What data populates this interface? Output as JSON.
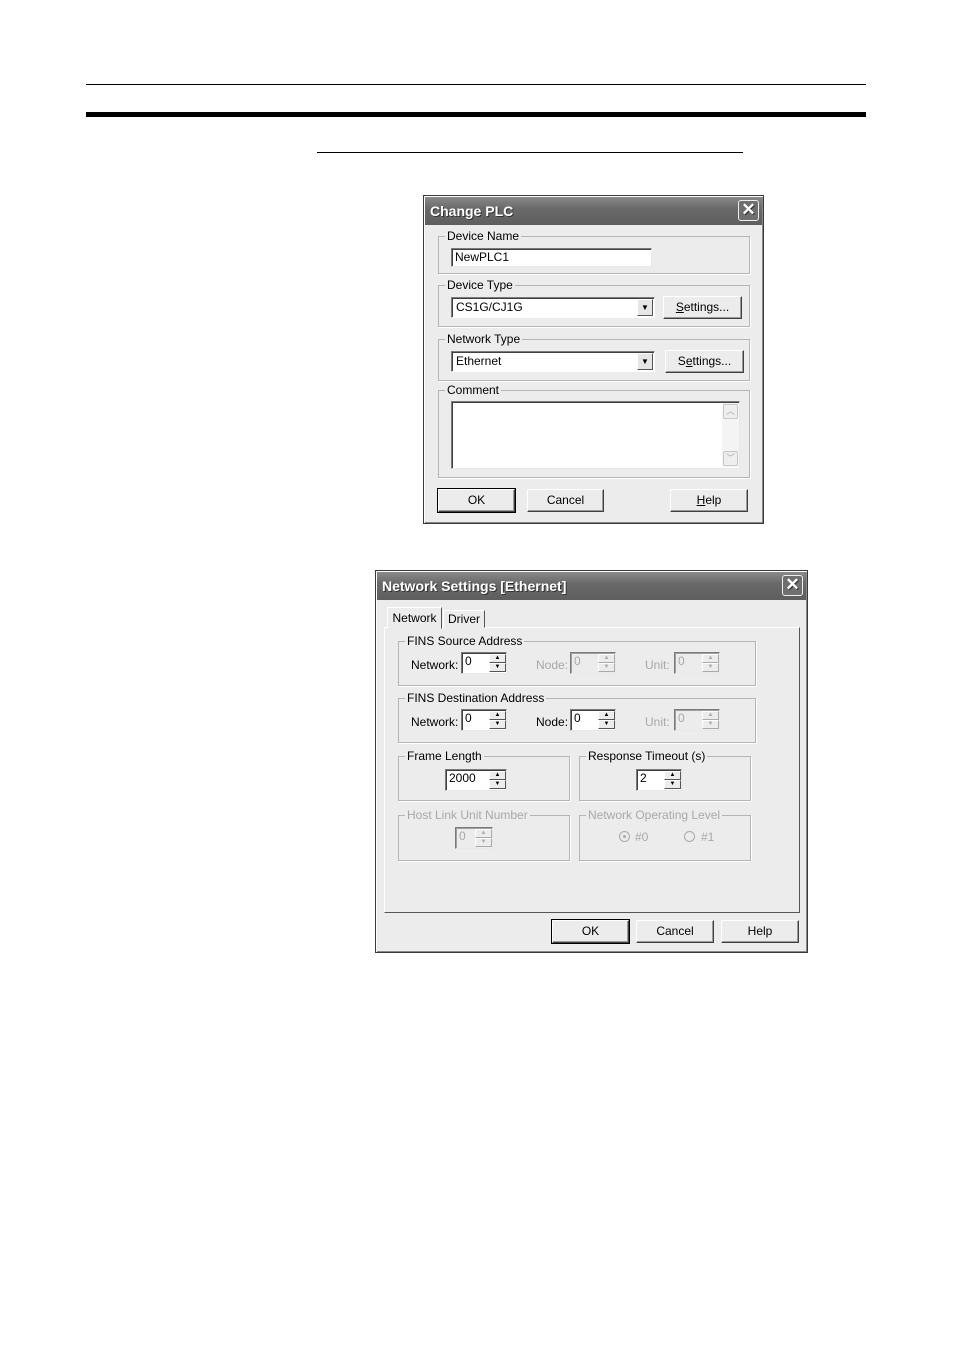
{
  "change_plc": {
    "title": "Change PLC",
    "close_icon": "close-icon",
    "device_name": {
      "label": "Device Name",
      "value": "NewPLC1"
    },
    "device_type": {
      "label": "Device Type",
      "value": "CS1G/CJ1G",
      "settings_label": "Settings..."
    },
    "network_type": {
      "label": "Network Type",
      "value": "Ethernet",
      "settings_label": "Settings..."
    },
    "comment": {
      "label": "Comment",
      "value": ""
    },
    "buttons": {
      "ok": "OK",
      "cancel": "Cancel",
      "help": "Help"
    }
  },
  "network_settings": {
    "title": "Network Settings [Ethernet]",
    "close_icon": "close-icon",
    "tabs": [
      {
        "label": "Network",
        "active": true
      },
      {
        "label": "Driver",
        "active": false
      }
    ],
    "fins_source": {
      "label": "FINS Source Address",
      "network": {
        "label": "Network:",
        "value": "0",
        "enabled": true
      },
      "node": {
        "label": "Node:",
        "value": "0",
        "enabled": false
      },
      "unit": {
        "label": "Unit:",
        "value": "0",
        "enabled": false
      }
    },
    "fins_destination": {
      "label": "FINS Destination Address",
      "network": {
        "label": "Network:",
        "value": "0",
        "enabled": true
      },
      "node": {
        "label": "Node:",
        "value": "0",
        "enabled": true
      },
      "unit": {
        "label": "Unit:",
        "value": "0",
        "enabled": false
      }
    },
    "frame_length": {
      "label": "Frame Length",
      "value": "2000"
    },
    "response_timeout": {
      "label": "Response Timeout (s)",
      "value": "2"
    },
    "host_link_unit": {
      "label": "Host Link Unit Number",
      "value": "0",
      "enabled": false
    },
    "network_operating_level": {
      "label": "Network Operating Level",
      "enabled": false,
      "options": [
        {
          "label": "#0",
          "selected": true
        },
        {
          "label": "#1",
          "selected": false
        }
      ]
    },
    "buttons": {
      "ok": "OK",
      "cancel": "Cancel",
      "help": "Help"
    }
  }
}
